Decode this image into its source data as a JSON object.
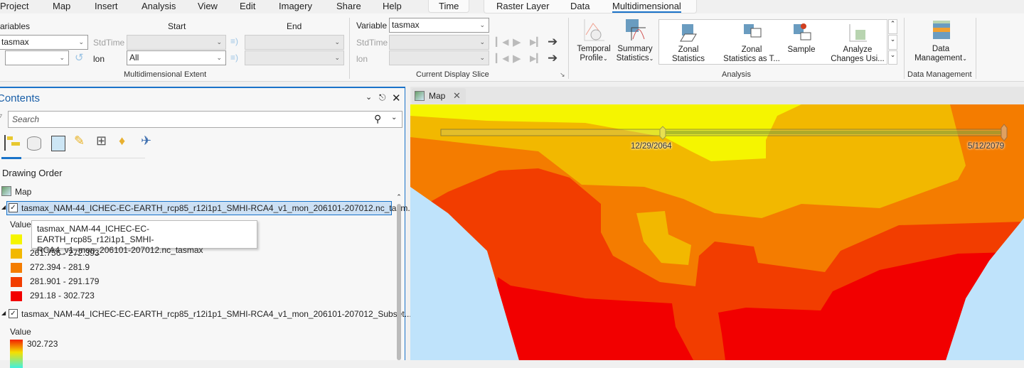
{
  "menu_tabs": [
    "Project",
    "Map",
    "Insert",
    "Analysis",
    "View",
    "Edit",
    "Imagery",
    "Share",
    "Help"
  ],
  "context_tabs": {
    "time": "Time",
    "raster_layer": "Raster Layer",
    "data": "Data",
    "multidimensional": "Multidimensional"
  },
  "extent": {
    "variables_label": "ariables",
    "variable_value": "tasmax",
    "stdtime_label": "StdTime",
    "lon_label": "lon",
    "lon_value": "All",
    "start_label": "Start",
    "end_label": "End",
    "group_label": "Multidimensional Extent"
  },
  "slice": {
    "variable_label": "Variable",
    "variable_value": "tasmax",
    "stdtime_label": "StdTime",
    "lon_label": "lon",
    "group_label": "Current Display Slice"
  },
  "analysis": {
    "temporal_profile": [
      "Temporal",
      "Profile"
    ],
    "summary_statistics": [
      "Summary",
      "Statistics"
    ],
    "zonal_statistics": [
      "Zonal",
      "Statistics"
    ],
    "zonal_statistics_table": [
      "Zonal",
      "Statistics as T..."
    ],
    "sample": "Sample",
    "analyze_changes": [
      "Analyze",
      "Changes Usi..."
    ],
    "group_label": "Analysis"
  },
  "data_management": {
    "button": [
      "Data",
      "Management"
    ],
    "group_label": "Data Management"
  },
  "contents": {
    "title": "Contents",
    "search_placeholder": "Search",
    "drawing_order": "Drawing Order",
    "map_label": "Map",
    "layer1": {
      "name": "tasmax_NAM-44_ICHEC-EC-EARTH_rcp85_r12i1p1_SMHI-RCA4_v1_mon_206101-207012.nc_tasm...",
      "value_label": "Value",
      "classes": [
        {
          "label": "",
          "color": "#f5f500"
        },
        {
          "label": "261.756 - 272.393",
          "color": "#f2b800"
        },
        {
          "label": "272.394 - 281.9",
          "color": "#f47c00"
        },
        {
          "label": "281.901 - 291.179",
          "color": "#f23d00"
        },
        {
          "label": "291.18 - 302.723",
          "color": "#f20000"
        }
      ]
    },
    "tooltip": [
      "tasmax_NAM-44_ICHEC-EC-EARTH_rcp85_r12i1p1_SMHI-",
      "RCA4_v1_mon_206101-207012.nc_tasmax"
    ],
    "layer2": {
      "name": "tasmax_NAM-44_ICHEC-EC-EARTH_rcp85_r12i1p1_SMHI-RCA4_v1_mon_206101-207012_Subset....",
      "value_label": "Value",
      "max": "302.723"
    }
  },
  "map": {
    "tab_label": "Map",
    "time_start": "12/29/2064",
    "time_end": "5/12/2079"
  }
}
